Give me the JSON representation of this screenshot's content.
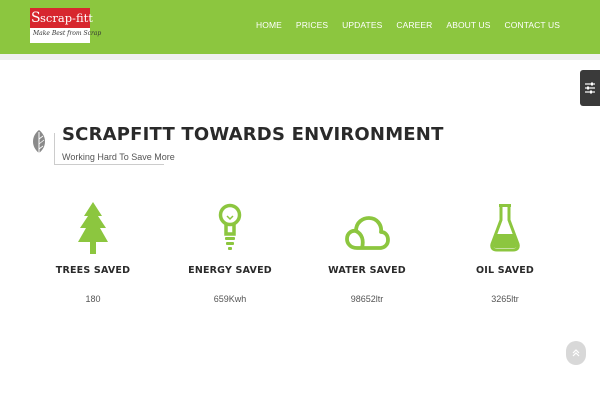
{
  "brand": {
    "logo_s": "S",
    "logo_name": "scrap-fitt",
    "tagline": "Make Best from Scrap",
    "accent_color": "#8cc63f",
    "logo_red": "#d7262e"
  },
  "nav": {
    "items": [
      {
        "label": "HOME",
        "icon": null
      },
      {
        "label": "PRICES",
        "icon": null
      },
      {
        "label": "UPDATES",
        "icon": null
      },
      {
        "label": "CAREER",
        "icon": null
      },
      {
        "label": "ABOUT US",
        "icon": null
      },
      {
        "label": "CONTACT US",
        "icon": null
      }
    ]
  },
  "section": {
    "icon": "leaf-icon",
    "title": "SCRAPFITT TOWARDS ENVIRONMENT",
    "subtitle": "Working Hard To Save More"
  },
  "stats": [
    {
      "icon": "tree-icon",
      "title": "TREES SAVED",
      "value": "180"
    },
    {
      "icon": "bulb-icon",
      "title": "ENERGY SAVED",
      "value": "659Kwh"
    },
    {
      "icon": "cloud-icon",
      "title": "WATER SAVED",
      "value": "98652ltr"
    },
    {
      "icon": "flask-icon",
      "title": "OIL SAVED",
      "value": "3265ltr"
    }
  ],
  "widgets": {
    "settings_icon": "sliders-icon",
    "scroll_top_icon": "chevron-up-icon"
  }
}
